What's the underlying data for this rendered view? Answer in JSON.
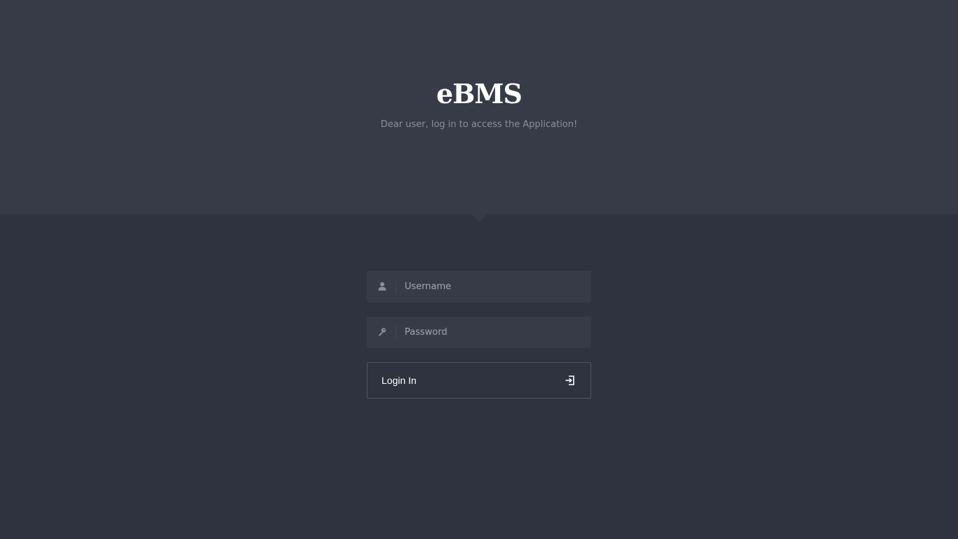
{
  "header": {
    "title": "eBMS",
    "subtitle": "Dear user, log in to access the Application!"
  },
  "form": {
    "username": {
      "placeholder": "Username",
      "value": "",
      "icon": "user-icon"
    },
    "password": {
      "placeholder": "Password",
      "value": "",
      "icon": "key-icon"
    },
    "submit": {
      "label": "Login In",
      "icon": "sign-in-icon"
    }
  },
  "colors": {
    "page_background": "#2f3340",
    "header_background": "#373b48",
    "field_background": "#373b48",
    "text_primary": "#ffffff",
    "text_muted": "#8b8e98"
  }
}
